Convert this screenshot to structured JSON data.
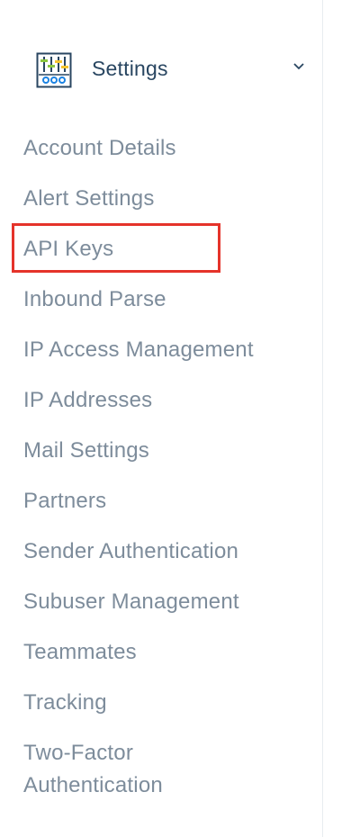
{
  "section": {
    "title": "Settings",
    "icon": "settings-sliders-icon",
    "chevron_icon": "chevron-down-icon"
  },
  "menu": {
    "items": [
      {
        "label": "Account Details"
      },
      {
        "label": "Alert Settings"
      },
      {
        "label": "API Keys"
      },
      {
        "label": "Inbound Parse"
      },
      {
        "label": "IP Access Management"
      },
      {
        "label": "IP Addresses"
      },
      {
        "label": "Mail Settings"
      },
      {
        "label": "Partners"
      },
      {
        "label": "Sender Authentication"
      },
      {
        "label": "Subuser Management"
      },
      {
        "label": "Teammates"
      },
      {
        "label": "Tracking"
      },
      {
        "label": "Two-Factor Authentication"
      }
    ]
  },
  "colors": {
    "section_title": "#294661",
    "menu_text": "#7d8c9b",
    "highlight_border": "#e5332a",
    "icon_green": "#8cc63f",
    "icon_yellow": "#f4c430",
    "icon_blue": "#1a82e2"
  }
}
